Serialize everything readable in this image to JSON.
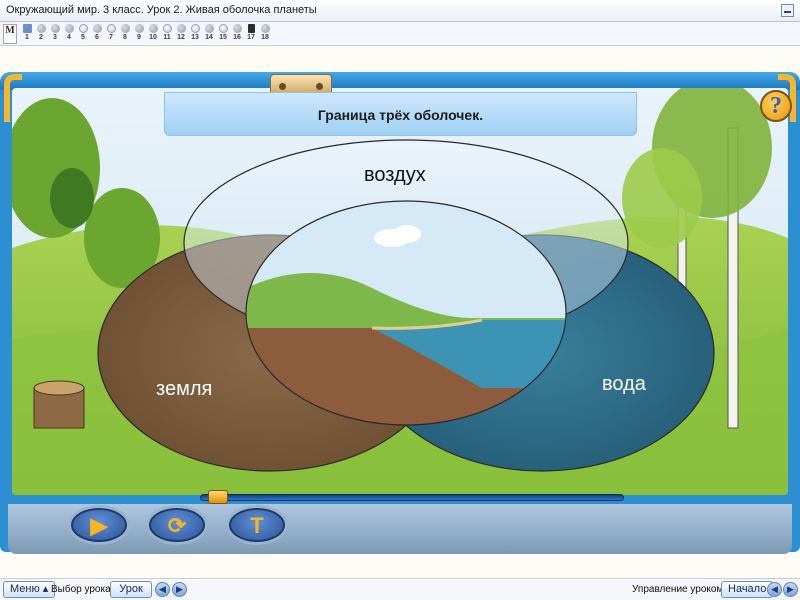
{
  "window": {
    "title": "Окружающий мир. 3 класс. Урок 2. Живая оболочка планеты"
  },
  "navstrip": {
    "logo_text": "М",
    "slides": [
      {
        "label": "1",
        "kind": "video"
      },
      {
        "label": "2",
        "kind": "dot"
      },
      {
        "label": "3",
        "kind": "dot"
      },
      {
        "label": "4",
        "kind": "dot"
      },
      {
        "label": "5",
        "kind": "test"
      },
      {
        "label": "6",
        "kind": "dot"
      },
      {
        "label": "7",
        "kind": "test"
      },
      {
        "label": "8",
        "kind": "dot"
      },
      {
        "label": "9",
        "kind": "dot"
      },
      {
        "label": "10",
        "kind": "dot"
      },
      {
        "label": "11",
        "kind": "test"
      },
      {
        "label": "12",
        "kind": "dot"
      },
      {
        "label": "13",
        "kind": "test"
      },
      {
        "label": "14",
        "kind": "dot"
      },
      {
        "label": "15",
        "kind": "test"
      },
      {
        "label": "16",
        "kind": "dot"
      },
      {
        "label": "17",
        "kind": "bw"
      },
      {
        "label": "18",
        "kind": "dot"
      }
    ]
  },
  "slide": {
    "title": "Граница трёх оболочек.",
    "help_glyph": "?",
    "venn": {
      "air_label": "воздух",
      "land_label": "земля",
      "water_label": "вода"
    }
  },
  "controls": {
    "play_glyph": "▶",
    "reload_glyph": "⟳",
    "text_glyph": "T",
    "progress": 0.02
  },
  "statusbar": {
    "menu_label": "Меню ▴",
    "lesson_choice_label": "Выбор урока:",
    "lesson_button": "Урок",
    "prev_arrow": "◀",
    "next_arrow": "▶",
    "control_label": "Управление уроком:",
    "start_button": "Начало"
  },
  "colors": {
    "frame": "#2b8fd2",
    "accent_orange": "#f5b72b",
    "title_panel": "#b7dcf7",
    "earth": "#7a5a3c",
    "water": "#2f6f8a",
    "sky": "#dcebf7"
  }
}
